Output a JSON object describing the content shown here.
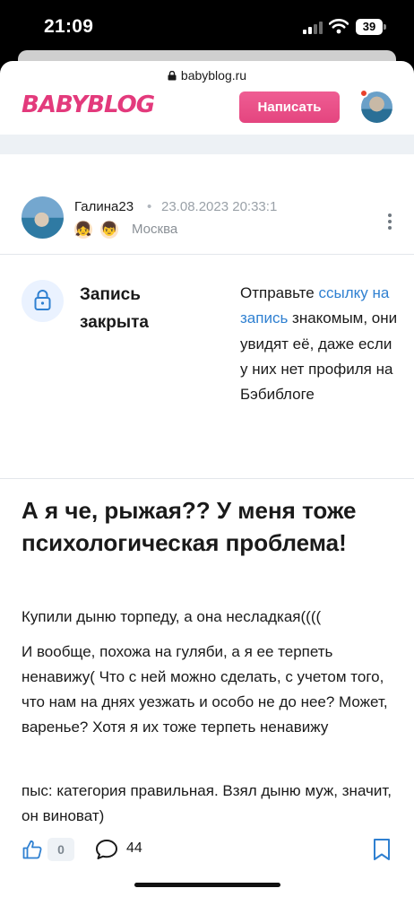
{
  "status_bar": {
    "time": "21:09",
    "battery": "39"
  },
  "browser": {
    "url": "babyblog.ru"
  },
  "header": {
    "logo": "BABYBLOG",
    "write_button": "Написать"
  },
  "author": {
    "name": "Галина23",
    "separator": "•",
    "date": "23.08.2023 20:33:1",
    "city": "Москва",
    "badges": [
      "👧",
      "👦"
    ]
  },
  "closed_notice": {
    "title": "Запись закрыта",
    "text_before": "Отправьте ",
    "link": "ссылку на запись",
    "text_after": " знакомым, они увидят её, даже если у них нет профиля на Бэбиблоге"
  },
  "post": {
    "title": "А я че, рыжая?? У меня тоже психологическая проблема!",
    "paragraphs": [
      "Купили дыню торпеду, а она несладкая((((",
      "И вообще, похожа на гуляби, а я ее терпеть ненавижу( Что с ней можно сделать, с учетом того, что нам на днях уезжать и особо не до нее? Может, варенье? Хотя я их тоже терпеть ненавижу",
      "пыс: категория правильная. Взял дыню муж, значит, он виноват)"
    ]
  },
  "actions": {
    "likes": "0",
    "comments": "44"
  },
  "colors": {
    "brand_pink": "#e4457f",
    "link_blue": "#2f80d1"
  },
  "icons": [
    "lock-icon",
    "thumbs-up-icon",
    "comment-icon",
    "bookmark-icon",
    "more-icon",
    "wifi-icon",
    "signal-icon",
    "battery-icon"
  ]
}
